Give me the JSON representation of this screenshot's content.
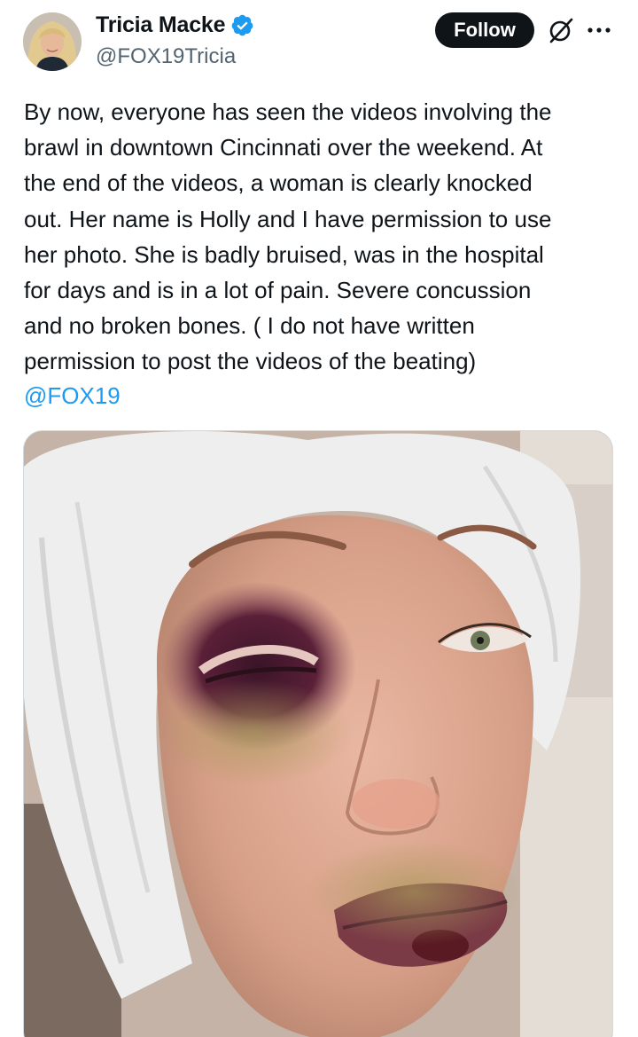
{
  "author": {
    "display_name": "Tricia Macke",
    "handle": "@FOX19Tricia",
    "verified_icon": "verified-badge-icon",
    "avatar_icon": "profile-avatar"
  },
  "actions": {
    "follow_label": "Follow",
    "grok_icon": "grok-icon",
    "more_icon": "more-dots-icon"
  },
  "tweet": {
    "text": "By now, everyone has seen the videos involving the\nbrawl in downtown Cincinnati over the weekend.  At\nthe end of the videos, a woman is clearly knocked\nout.   Her name is Holly and I have permission to use\nher photo.  She is badly bruised, was in the hospital\nfor days and is in a lot of pain.  Severe concussion\nand no broken bones. ( I do not have written\npermission to post the videos of the beating)",
    "mention": "@FOX19"
  },
  "media": {
    "type": "photo"
  },
  "colors": {
    "link": "#1d9bf0",
    "verified": "#1d9bf0",
    "text_primary": "#0f1419",
    "text_secondary": "#536471",
    "follow_bg": "#0f1419"
  }
}
